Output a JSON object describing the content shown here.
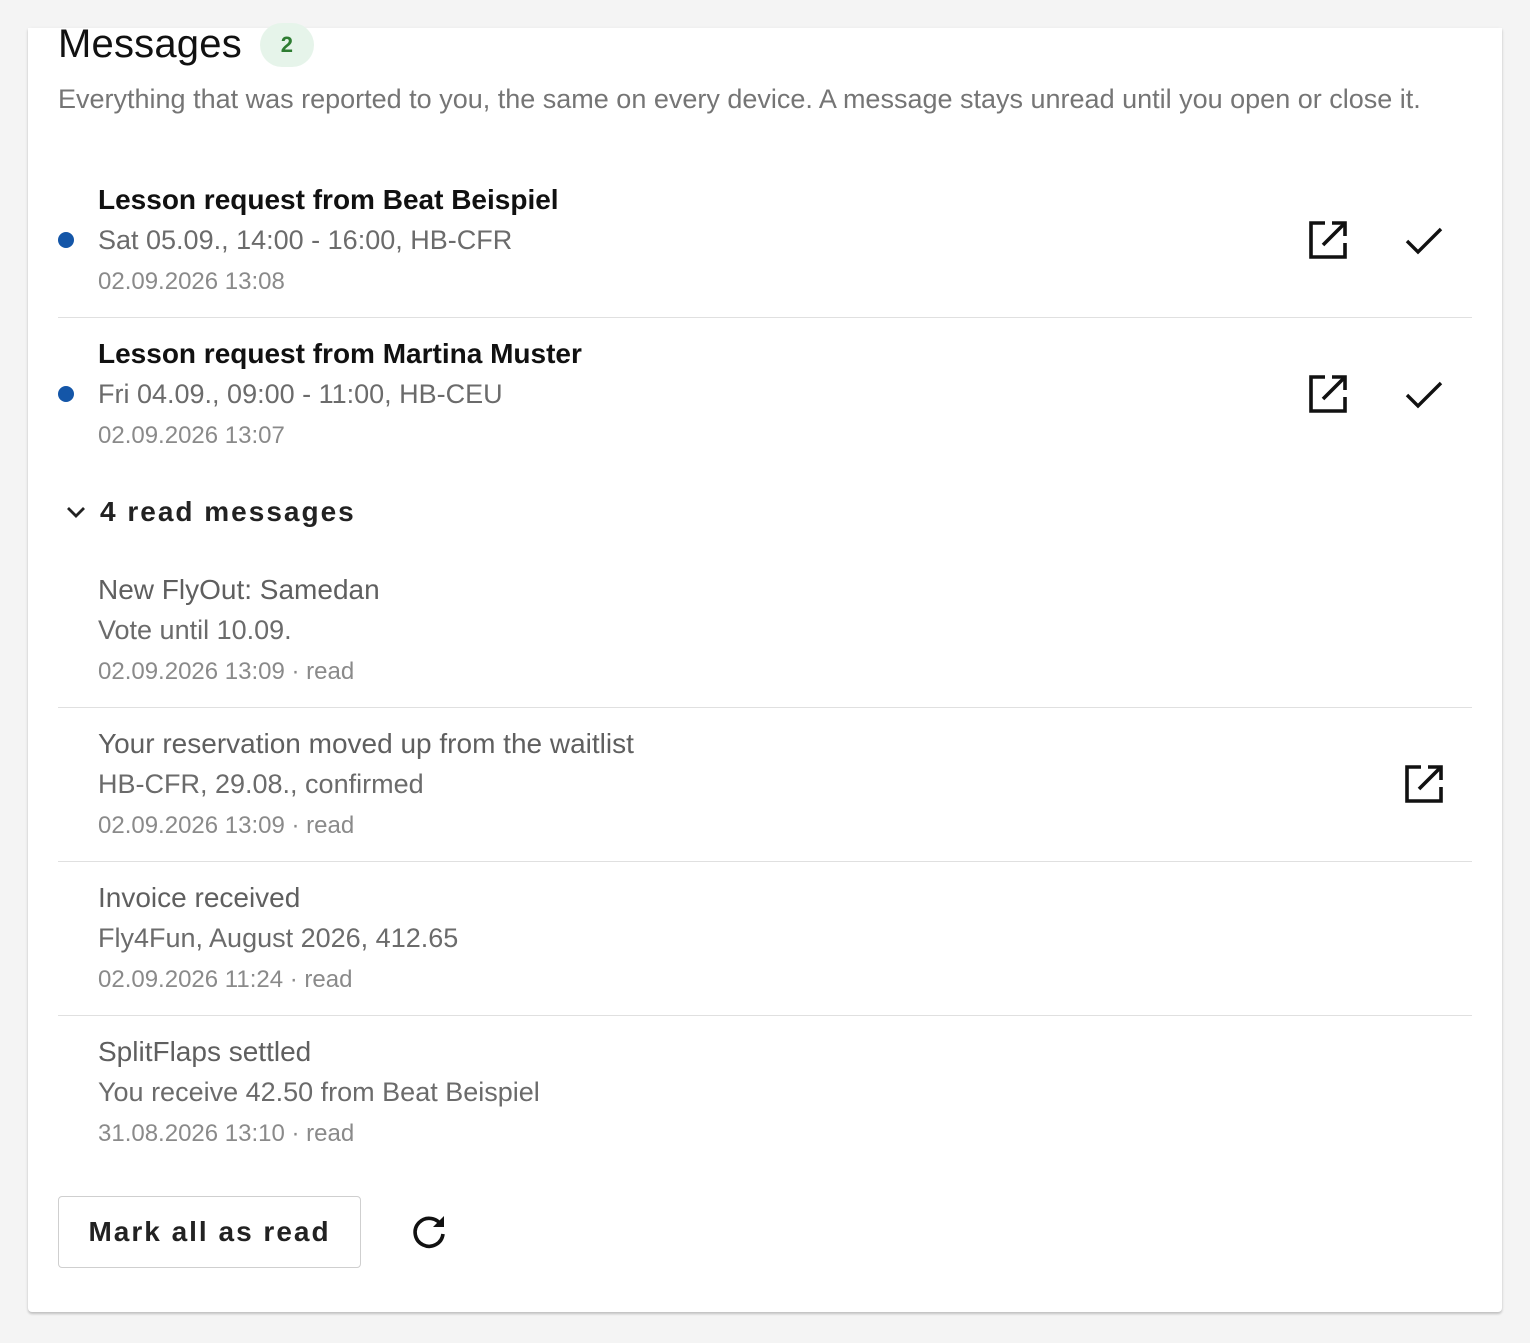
{
  "panel": {
    "title": "Messages",
    "unread_count": "2",
    "description": "Everything that was reported to you, the same on every device. A message stays unread until you open or close it."
  },
  "unread": [
    {
      "title": "Lesson request from Beat Beispiel",
      "detail": "Sat 05.09., 14:00 - 16:00, HB-CFR",
      "time": "02.09.2026 13:08"
    },
    {
      "title": "Lesson request from Martina Muster",
      "detail": "Fri 04.09., 09:00 - 11:00, HB-CEU",
      "time": "02.09.2026 13:07"
    }
  ],
  "read_section": {
    "toggle_label": "4 read messages",
    "items": [
      {
        "title": "New FlyOut: Samedan",
        "detail": "Vote until 10.09.",
        "time": "02.09.2026 13:09 · read"
      },
      {
        "title": "Your reservation moved up from the waitlist",
        "detail": "HB-CFR, 29.08., confirmed",
        "time": "02.09.2026 13:09 · read"
      },
      {
        "title": "Invoice received",
        "detail": "Fly4Fun, August 2026, 412.65",
        "time": "02.09.2026 11:24 · read"
      },
      {
        "title": "SplitFlaps settled",
        "detail": "You receive 42.50 from Beat Beispiel",
        "time": "31.08.2026 13:10 · read"
      }
    ]
  },
  "actions": {
    "mark_all_label": "Mark all as read"
  },
  "icons": {
    "open": "open-in-new-icon",
    "dismiss": "check-icon",
    "toggle": "chevron-down-icon",
    "refresh": "refresh-icon"
  },
  "colors": {
    "unread_dot": "#1456a8",
    "badge_bg": "#e6f4ea",
    "badge_text": "#2e7d32"
  }
}
